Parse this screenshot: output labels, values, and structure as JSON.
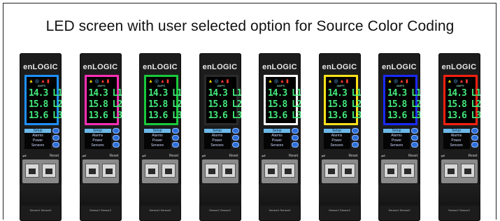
{
  "title": "LED screen with user selected option for Source Color Coding",
  "units": [
    {
      "brand": "enLOGIC",
      "screen_color": "#1e90ff",
      "readings": [
        "14.3 L1",
        "15.8 L2",
        "13.6 L3"
      ]
    },
    {
      "brand": "enLOGIC",
      "screen_color": "#ff2fb4",
      "readings": [
        "14.3 L1",
        "15.8 L2",
        "13.6 L3"
      ]
    },
    {
      "brand": "enLOGIC",
      "screen_color": "#19c93a",
      "readings": [
        "14.3 L1",
        "15.8 L2",
        "13.6 L3"
      ]
    },
    {
      "brand": "enLOGIC",
      "screen_color": "#050505",
      "readings": [
        "14.3 L1",
        "15.8 L2",
        "13.6 L3"
      ]
    },
    {
      "brand": "enLOGIC",
      "screen_color": "#ffffff",
      "readings": [
        "14.3 L1",
        "15.8 L2",
        "13.6 L3"
      ]
    },
    {
      "brand": "enLOGIC",
      "screen_color": "#ffe21a",
      "readings": [
        "14.3 L1",
        "15.8 L2",
        "13.6 L3"
      ]
    },
    {
      "brand": "enLOGIC",
      "screen_color": "#1a2bff",
      "readings": [
        "14.3 L1",
        "15.8 L2",
        "13.6 L3"
      ]
    },
    {
      "brand": "enLOGIC",
      "screen_color": "#ff2010",
      "readings": [
        "14.3 L1",
        "15.8 L2",
        "13.6 L3"
      ]
    }
  ],
  "menu": [
    "Setup",
    "Alarms",
    "Power",
    "Sensors"
  ],
  "menu_selected": 0,
  "amps_label": "AMPS",
  "reset_label": "Reset",
  "sensor_labels": [
    "Sensor1",
    "Sensor2"
  ],
  "icons": {
    "usb": "usb-icon",
    "warning": "warning-icon",
    "network": "network-icon",
    "alert": "alert-icon"
  }
}
